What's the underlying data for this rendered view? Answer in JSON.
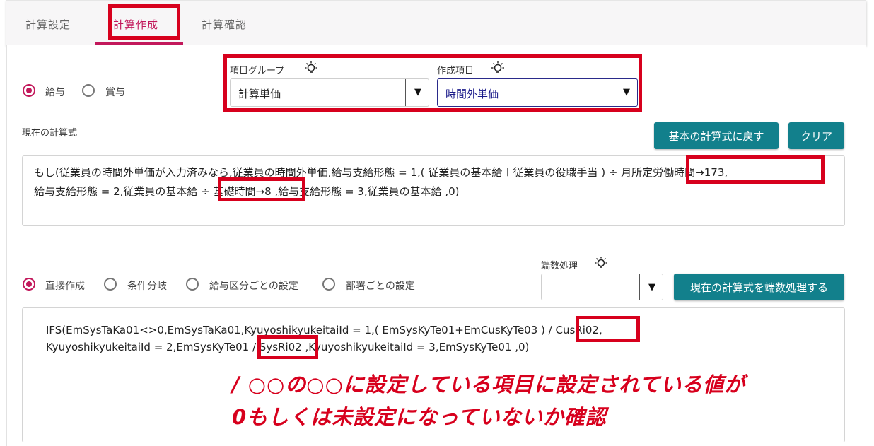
{
  "tabs": [
    {
      "label": "計算設定"
    },
    {
      "label": "計算作成"
    },
    {
      "label": "計算確認"
    }
  ],
  "pay_type": {
    "options": [
      {
        "label": "給与"
      },
      {
        "label": "賞与"
      }
    ]
  },
  "item_group": {
    "label": "項目グループ",
    "value": "計算単価"
  },
  "create_item": {
    "label": "作成項目",
    "value": "時間外単価"
  },
  "current_formula": {
    "label": "現在の計算式",
    "reset_button": "基本の計算式に戻す",
    "clear_button": "クリア",
    "line1_a": "もし(従業員の時間外単価が入力済みなら,従業員の時間外単価,給与支給形態 = 1,( 従業員の基本給＋従業員の役職手当 ) ",
    "line1_b": "÷ 月所定労働時間→173",
    "line1_c": ",",
    "line2_a": "給与支給形態 = 2,従業員の基本給 ",
    "line2_b": "÷ 基礎時間→8",
    "line2_c": " ,給与支給形態 = 3,従業員の基本給  ,0)"
  },
  "creation_mode": {
    "options": [
      {
        "label": "直接作成"
      },
      {
        "label": "条件分岐"
      },
      {
        "label": "給与区分ごとの設定"
      },
      {
        "label": "部署ごとの設定"
      }
    ]
  },
  "rounding": {
    "label": "端数処理",
    "value": "",
    "apply_button": "現在の計算式を端数処理する"
  },
  "raw_formula": {
    "line1_a": "IFS(EmSysTaKa01<>0,EmSysTaKa01,KyuyoshikyukeitaiId = 1,( EmSysKyTe01+EmCusKyTe03 ) ",
    "line1_b": "/ CusRi02",
    "line1_c": ",",
    "line2_a": "KyuyoshikyukeitaiId = 2,EmSysKyTe01 ",
    "line2_b": "/ SysRi02",
    "line2_c": " ,KyuyoshikyukeitaiId = 3,EmSysKyTe01  ,0)"
  },
  "annotation": {
    "line1": "/ ○○の○○に設定している項目に設定されている値が",
    "line2": "0もしくは未設定になっていないか確認"
  },
  "colors": {
    "accent": "#c2185b",
    "button": "#12808c",
    "highlight": "#d7001d"
  }
}
